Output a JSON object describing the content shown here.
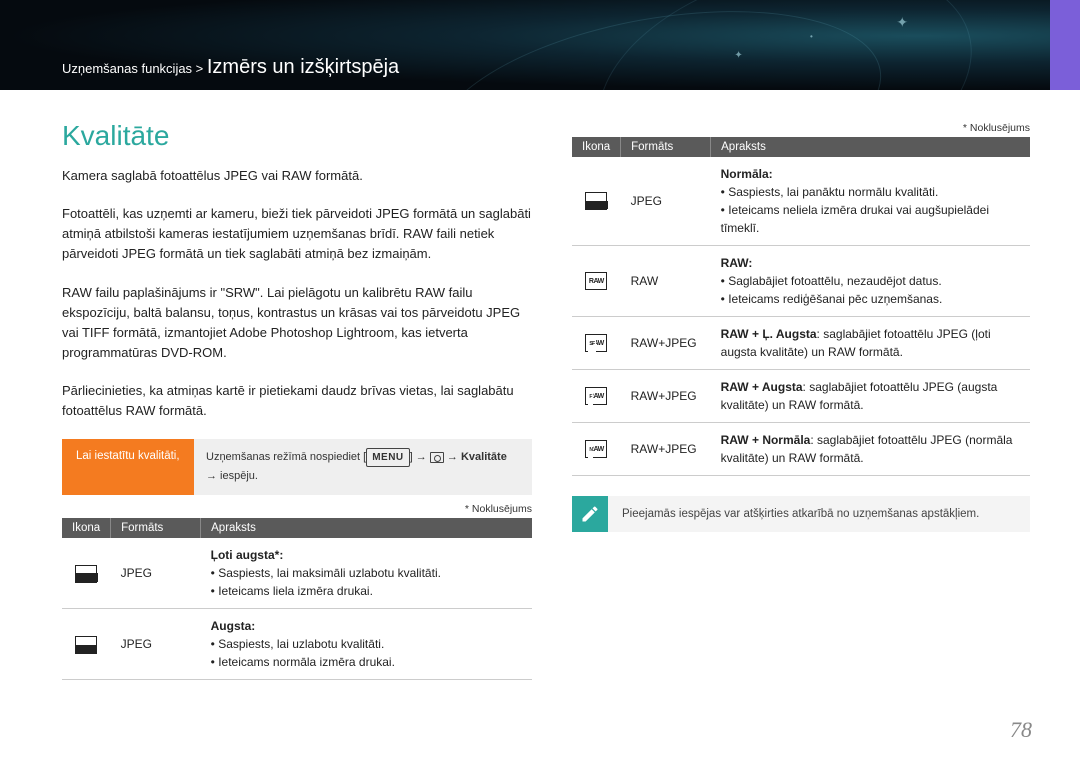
{
  "header": {
    "breadcrumb_prefix": "Uzņemšanas funkcijas > ",
    "breadcrumb_main": "Izmērs un izšķirtspēja"
  },
  "left": {
    "title": "Kvalitāte",
    "p1": "Kamera saglabā fotoattēlus JPEG vai RAW formātā.",
    "p2": "Fotoattēli, kas uzņemti ar kameru, bieži tiek pārveidoti JPEG formātā un saglabāti atmiņā atbilstoši kameras iestatījumiem uzņemšanas brīdī. RAW faili netiek pārveidoti JPEG formātā un tiek saglabāti atmiņā bez izmaiņām.",
    "p3": "RAW failu paplašinājums ir \"SRW\". Lai pielāgotu un kalibrētu RAW failu ekspozīciju, baltā balansu, toņus, kontrastus un krāsas vai tos pārveidotu JPEG vai TIFF formātā, izmantojiet Adobe Photoshop Lightroom, kas ietverta programmatūras DVD-ROM.",
    "p4": "Pārliecinieties, ka atmiņas kartē ir pietiekami daudz brīvas vietas, lai saglabātu fotoattēlus RAW formātā.",
    "action_label": "Lai iestatītu kvalitāti,",
    "action_text_pre": "Uzņemšanas režīmā nospiediet ",
    "action_menu": "MENU",
    "action_kvalitate": "Kvalitāte",
    "action_text_post": " → iespēju.",
    "default_note": "* Noklusējums",
    "th_icon": "Ikona",
    "th_fmt": "Formāts",
    "th_desc": "Apraksts",
    "rows": [
      {
        "fmt": "JPEG",
        "title": "Ļoti augsta*:",
        "b1": "Saspiests, lai maksimāli uzlabotu kvalitāti.",
        "b2": "Ieteicams liela izmēra drukai."
      },
      {
        "fmt": "JPEG",
        "title": "Augsta:",
        "b1": "Saspiests, lai uzlabotu kvalitāti.",
        "b2": "Ieteicams normāla izmēra drukai."
      }
    ]
  },
  "right": {
    "default_note": "* Noklusējums",
    "th_icon": "Ikona",
    "th_fmt": "Formāts",
    "th_desc": "Apraksts",
    "rows": [
      {
        "fmt": "JPEG",
        "title": "Normāla:",
        "b1": "Saspiests, lai panāktu normālu kvalitāti.",
        "b2": "Ieteicams neliela izmēra drukai vai augšupielādei tīmeklī."
      },
      {
        "fmt": "RAW",
        "title": "RAW:",
        "b1": "Saglabājiet fotoattēlu, nezaudējot datus.",
        "b2": "Ieteicams rediģēšanai pēc uzņemšanas."
      },
      {
        "fmt": "RAW+JPEG",
        "desc_strong": "RAW + Ļ. Augsta",
        "desc_rest": ": saglabājiet fotoattēlu JPEG (ļoti augsta kvalitāte) un RAW formātā."
      },
      {
        "fmt": "RAW+JPEG",
        "desc_strong": "RAW + Augsta",
        "desc_rest": ": saglabājiet fotoattēlu JPEG (augsta kvalitāte) un RAW formātā."
      },
      {
        "fmt": "RAW+JPEG",
        "desc_strong": "RAW + Normāla",
        "desc_rest": ": saglabājiet fotoattēlu JPEG (normāla kvalitāte) un RAW formātā."
      }
    ],
    "tip": "Pieejamās iespējas var atšķirties atkarībā no uzņemšanas apstākļiem."
  },
  "page_number": "78"
}
